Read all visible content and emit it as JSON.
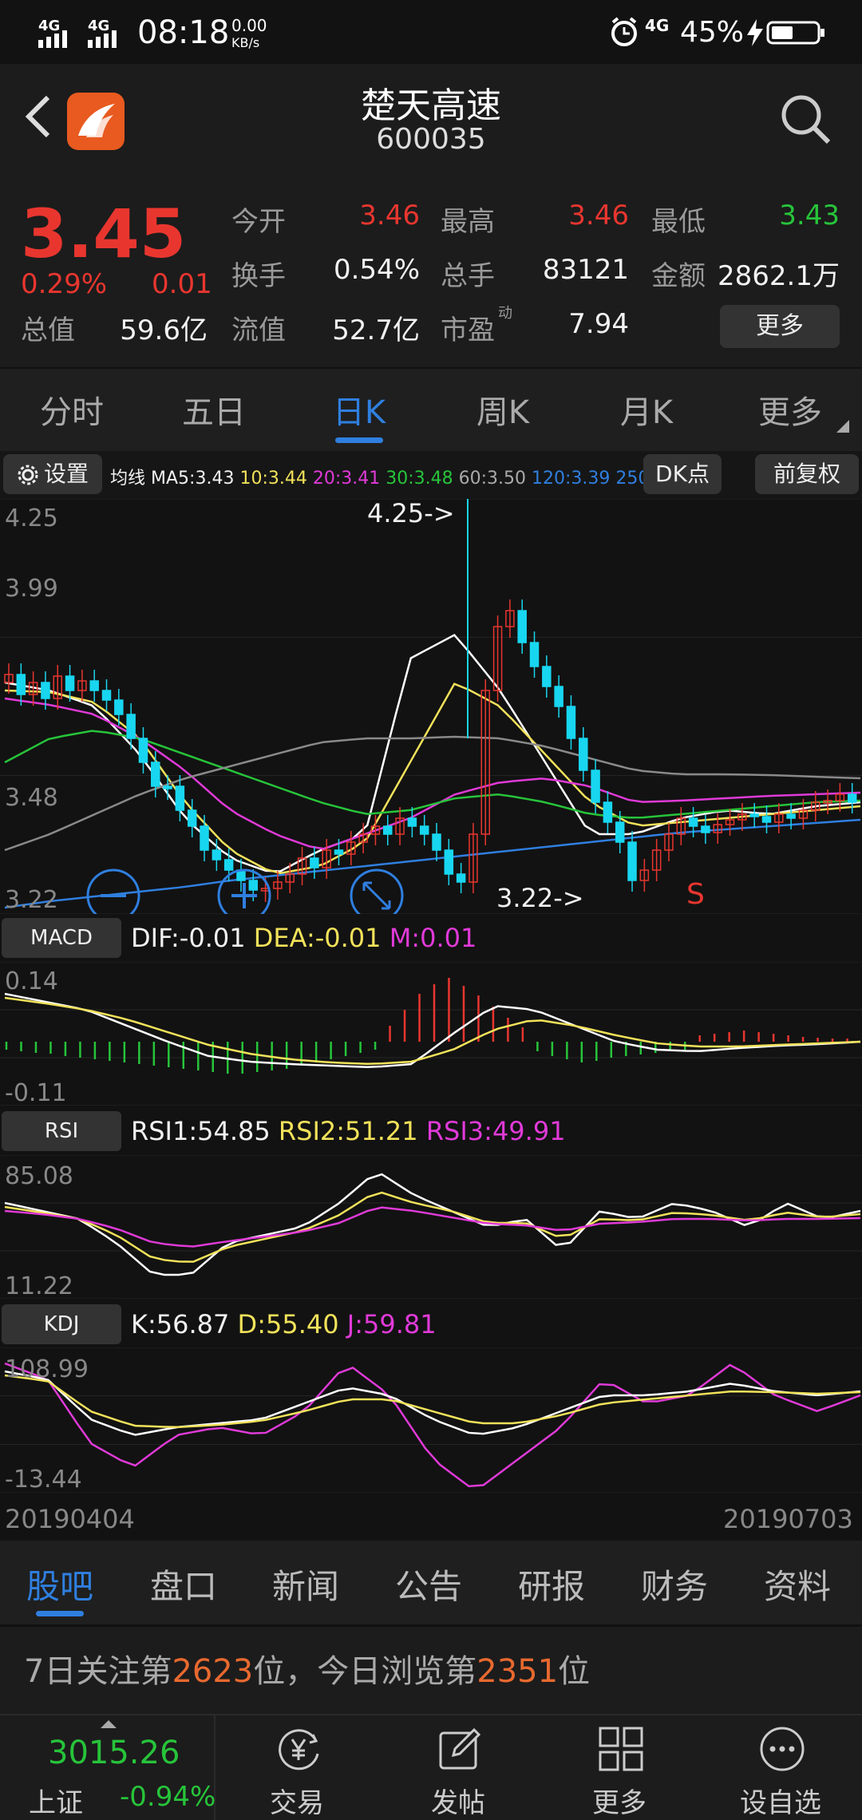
{
  "status": {
    "network1": "4G",
    "network2": "4G",
    "time": "08:18",
    "speed_value": "0.00",
    "speed_unit": "KB/s",
    "net_small": "4G",
    "battery": "45%"
  },
  "header": {
    "title": "楚天高速",
    "code": "600035"
  },
  "quote": {
    "price": "3.45",
    "change_pct": "0.29%",
    "change": "0.01",
    "fields": [
      {
        "label": "今开",
        "value": "3.46"
      },
      {
        "label": "最高",
        "value": "3.46"
      },
      {
        "label": "最低",
        "value": "3.43"
      },
      {
        "label": "换手",
        "value": "0.54%"
      },
      {
        "label": "总手",
        "value": "83121"
      },
      {
        "label": "金额",
        "value": "2862.1万"
      },
      {
        "label": "总值",
        "value": "59.6亿"
      },
      {
        "label": "流值",
        "value": "52.7亿"
      },
      {
        "label": "市盈",
        "value": "7.94"
      }
    ],
    "pe_sup": "动",
    "more": "更多"
  },
  "period_tabs": [
    "分时",
    "五日",
    "日K",
    "周K",
    "月K",
    "更多"
  ],
  "period_active": 2,
  "ma": {
    "settings": "设置",
    "label": "均线",
    "ma5": "MA5:3.43",
    "ma10": "10:3.44",
    "ma20": "20:3.41",
    "ma30": "30:3.48",
    "ma60": "60:3.50",
    "ma120": "120:3.39",
    "ma250": "250",
    "dk": "DK点",
    "fq": "前复权"
  },
  "kline": {
    "y_top": "4.25",
    "y_2": "3.99",
    "y_3": "3.48",
    "y_bottom": "3.22",
    "ann_high": "4.25->",
    "ann_low": "3.22->",
    "signal": "S"
  },
  "macd": {
    "name": "MACD",
    "dif": "DIF:-0.01",
    "dea": "DEA:-0.01",
    "m": "M:0.01",
    "top": "0.14",
    "bottom": "-0.11"
  },
  "rsi": {
    "name": "RSI",
    "r1": "RSI1:54.85",
    "r2": "RSI2:51.21",
    "r3": "RSI3:49.91",
    "top": "85.08",
    "bottom": "11.22"
  },
  "kdj": {
    "name": "KDJ",
    "k": "K:56.87",
    "d": "D:55.40",
    "j": "J:59.81",
    "top": "108.99",
    "bottom": "-13.44"
  },
  "dates": {
    "start": "20190404",
    "end": "20190703"
  },
  "bottom_tabs": [
    "股吧",
    "盘口",
    "新闻",
    "公告",
    "研报",
    "财务",
    "资料"
  ],
  "rank": {
    "p1": "7日关注第",
    "n1": "2623",
    "p2": "位，今日浏览第",
    "n2": "2351",
    "p3": "位"
  },
  "index": {
    "value": "3015.26",
    "name": "上证",
    "change": "-0.94%"
  },
  "toolbar": [
    "交易",
    "发帖",
    "更多",
    "设自选"
  ],
  "colors": {
    "up": "#e8362f",
    "down": "#27c43a",
    "cyan": "#18d6f0",
    "accent": "#2f7fe0"
  }
}
